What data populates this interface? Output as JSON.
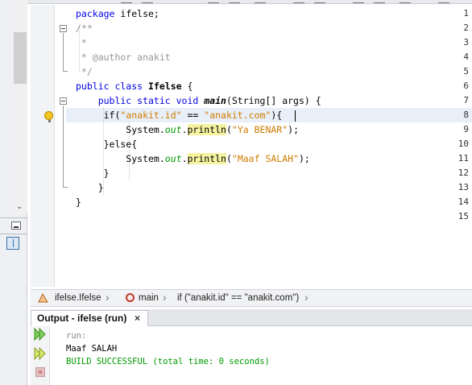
{
  "editor": {
    "lines": [
      {
        "num": "1",
        "parts": [
          {
            "t": "package ",
            "c": "kw"
          },
          {
            "t": "ifelse;",
            "c": ""
          }
        ]
      },
      {
        "num": "2",
        "parts": [
          {
            "t": "/**",
            "c": "cm"
          }
        ]
      },
      {
        "num": "3",
        "parts": [
          {
            "t": " *",
            "c": "cm"
          }
        ]
      },
      {
        "num": "4",
        "parts": [
          {
            "t": " * @author anakit",
            "c": "cm"
          }
        ]
      },
      {
        "num": "5",
        "parts": [
          {
            "t": " */",
            "c": "cm"
          }
        ]
      },
      {
        "num": "6",
        "parts": [
          {
            "t": "public class ",
            "c": "kw"
          },
          {
            "t": "Ifelse",
            "c": "cls"
          },
          {
            "t": " {",
            "c": ""
          }
        ]
      },
      {
        "num": "7",
        "parts": [
          {
            "t": "    public static void ",
            "c": "kw"
          },
          {
            "t": "main",
            "c": "fn"
          },
          {
            "t": "(String[] args) {",
            "c": ""
          }
        ]
      },
      {
        "num": "8",
        "parts": [
          {
            "t": "     if(",
            "c": ""
          },
          {
            "t": "\"anakit.id\"",
            "c": "str"
          },
          {
            "t": " == ",
            "c": ""
          },
          {
            "t": "\"anakit.com\"",
            "c": "str"
          },
          {
            "t": "){",
            "c": ""
          }
        ]
      },
      {
        "num": "9",
        "parts": [
          {
            "t": "         System.",
            "c": ""
          },
          {
            "t": "out",
            "c": "it-green"
          },
          {
            "t": ".",
            "c": ""
          },
          {
            "t": "println",
            "c": "hl-yellow"
          },
          {
            "t": "(",
            "c": ""
          },
          {
            "t": "\"Ya BENAR\"",
            "c": "str"
          },
          {
            "t": ");",
            "c": ""
          }
        ]
      },
      {
        "num": "10",
        "parts": [
          {
            "t": "     }else{",
            "c": ""
          }
        ]
      },
      {
        "num": "11",
        "parts": [
          {
            "t": "         System.",
            "c": ""
          },
          {
            "t": "out",
            "c": "it-green"
          },
          {
            "t": ".",
            "c": ""
          },
          {
            "t": "println",
            "c": "hl-yellow"
          },
          {
            "t": "(",
            "c": ""
          },
          {
            "t": "\"Maaf SALAH\"",
            "c": "str"
          },
          {
            "t": ");",
            "c": ""
          }
        ]
      },
      {
        "num": "12",
        "parts": [
          {
            "t": "     }",
            "c": ""
          }
        ]
      },
      {
        "num": "13",
        "parts": [
          {
            "t": "    }",
            "c": ""
          }
        ]
      },
      {
        "num": "14",
        "parts": [
          {
            "t": "}",
            "c": ""
          }
        ]
      },
      {
        "num": "15",
        "parts": []
      }
    ]
  },
  "breadcrumb": {
    "class_label": "ifelse.Ifelse",
    "method_label": "main",
    "statement_label": "if (\"anakit.id\" == \"anakit.com\")"
  },
  "output": {
    "tab_title": "Output - ifelse (run)",
    "close_glyph": "×",
    "run_label": "run:",
    "result_line": "Maaf SALAH",
    "build_line": "BUILD SUCCESSFUL (total time: 0 seconds)"
  },
  "colors": {
    "keyword": "#0000e6",
    "string": "#ce7b00",
    "comment": "#969696",
    "success": "#009900"
  }
}
